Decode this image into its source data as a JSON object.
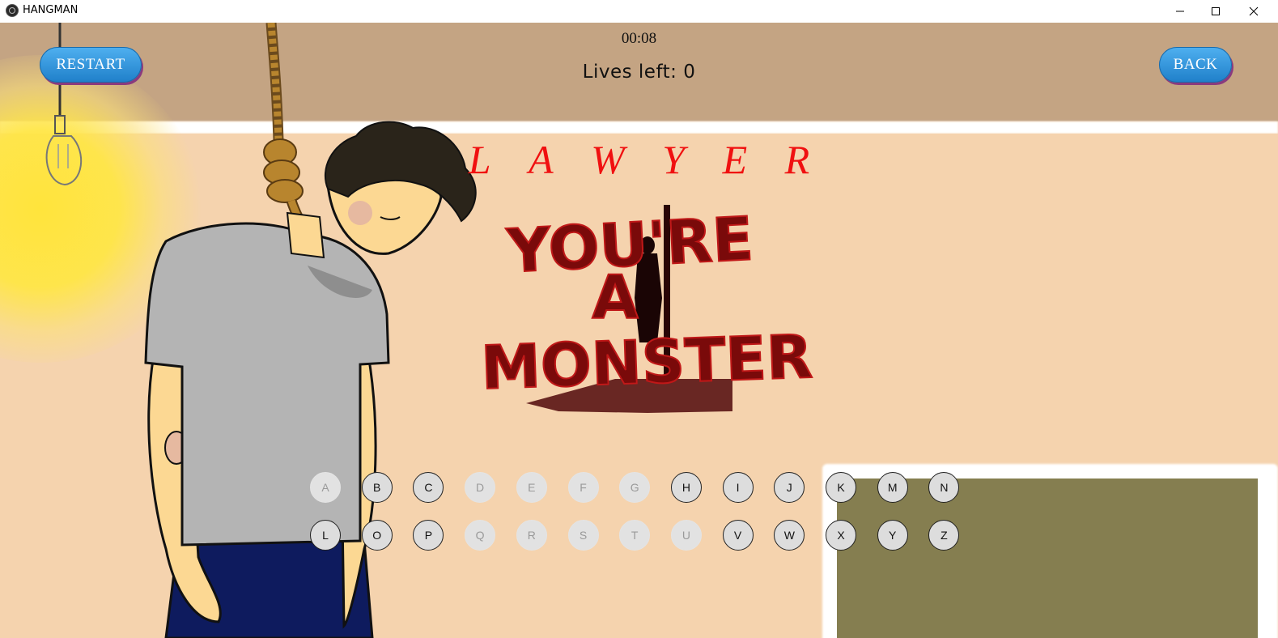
{
  "window": {
    "title": "HANGMAN"
  },
  "header": {
    "timer": "00:08",
    "lives_text": "Lives left: 0",
    "restart_label": "RESTART",
    "back_label": "BACK"
  },
  "word": {
    "letters": [
      "L",
      "A",
      "W",
      "Y",
      "E",
      "R"
    ]
  },
  "result_banner": {
    "lines": [
      "YOU'RE",
      "A",
      "MONSTER"
    ]
  },
  "keyboard": {
    "row1": [
      {
        "letter": "A",
        "used": true
      },
      {
        "letter": "B",
        "used": false
      },
      {
        "letter": "C",
        "used": false
      },
      {
        "letter": "D",
        "used": true
      },
      {
        "letter": "E",
        "used": true
      },
      {
        "letter": "F",
        "used": true
      },
      {
        "letter": "G",
        "used": true
      },
      {
        "letter": "H",
        "used": false
      },
      {
        "letter": "I",
        "used": false
      },
      {
        "letter": "J",
        "used": false
      },
      {
        "letter": "K",
        "used": false
      },
      {
        "letter": "M",
        "used": false
      },
      {
        "letter": "N",
        "used": false
      }
    ],
    "row2": [
      {
        "letter": "L",
        "used": false
      },
      {
        "letter": "O",
        "used": false
      },
      {
        "letter": "P",
        "used": false
      },
      {
        "letter": "Q",
        "used": true
      },
      {
        "letter": "R",
        "used": true
      },
      {
        "letter": "S",
        "used": true
      },
      {
        "letter": "T",
        "used": true
      },
      {
        "letter": "U",
        "used": true
      },
      {
        "letter": "V",
        "used": false
      },
      {
        "letter": "W",
        "used": false
      },
      {
        "letter": "X",
        "used": false
      },
      {
        "letter": "Y",
        "used": false
      },
      {
        "letter": "Z",
        "used": false
      }
    ]
  },
  "colors": {
    "word": "#f01010",
    "banner": "#7a0a0a",
    "button": "#2c8fdc",
    "wall_top": "#c4a483",
    "wall": "#f5d3ae",
    "board": "#857e50"
  }
}
